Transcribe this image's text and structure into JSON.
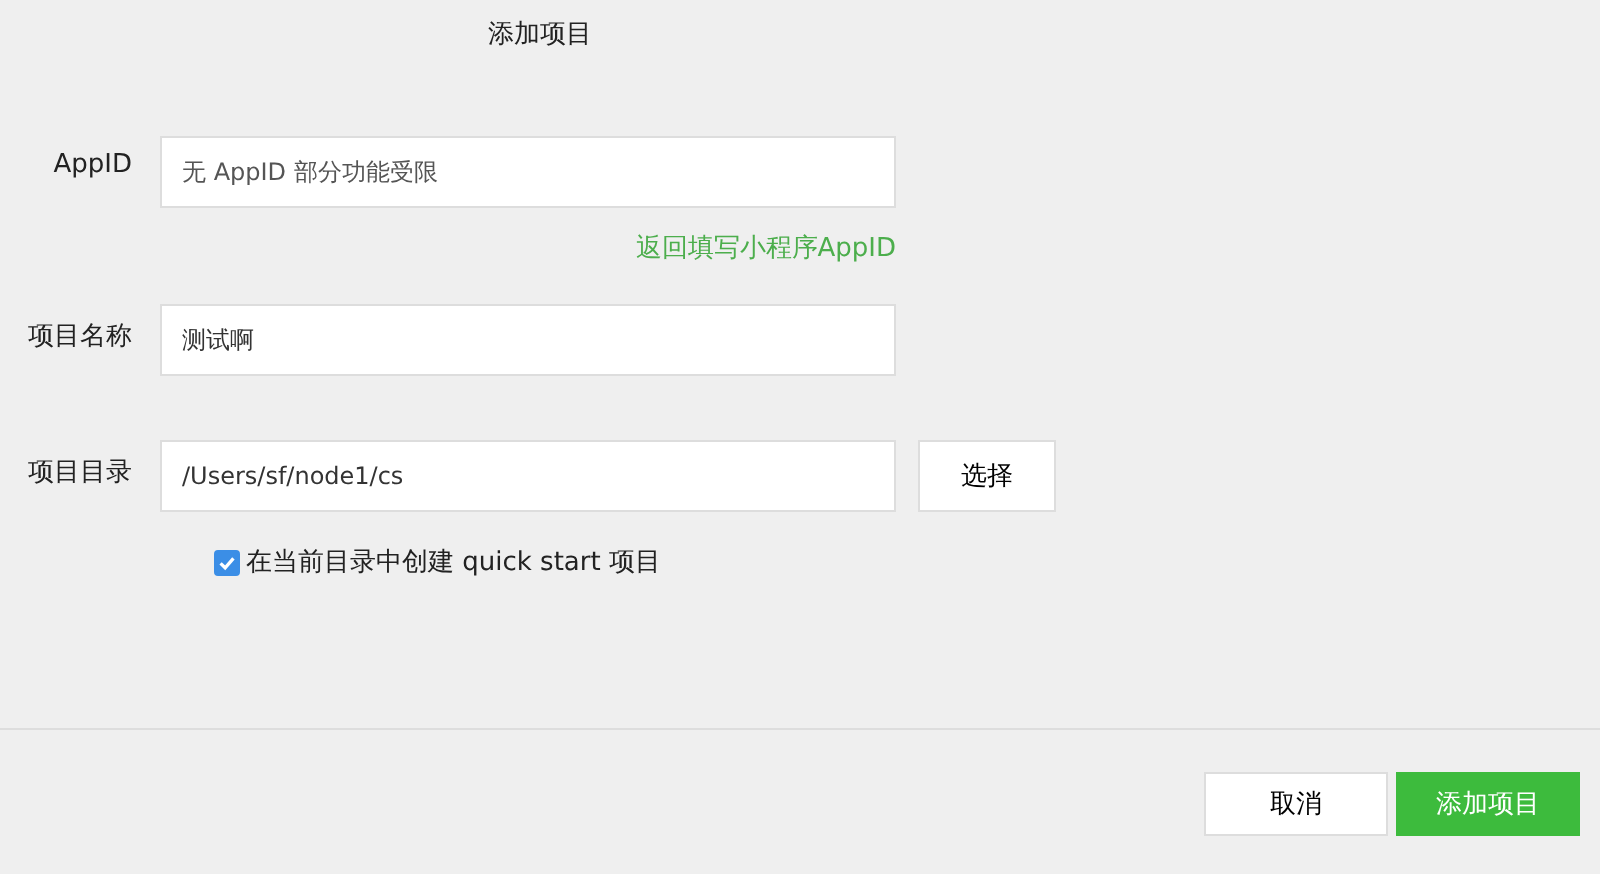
{
  "title": "添加项目",
  "appid": {
    "label": "AppID",
    "placeholder": "无 AppID 部分功能受限",
    "link": "返回填写小程序AppID"
  },
  "project_name": {
    "label": "项目名称",
    "value": "测试啊"
  },
  "project_dir": {
    "label": "项目目录",
    "value": "/Users/sf/node1/cs",
    "button": "选择"
  },
  "quick_start": {
    "label": "在当前目录中创建 quick start 项目",
    "checked": true
  },
  "buttons": [
    {
      "label": "取消",
      "kind": "secondary"
    },
    {
      "label": "添加项目",
      "kind": "primary"
    }
  ]
}
